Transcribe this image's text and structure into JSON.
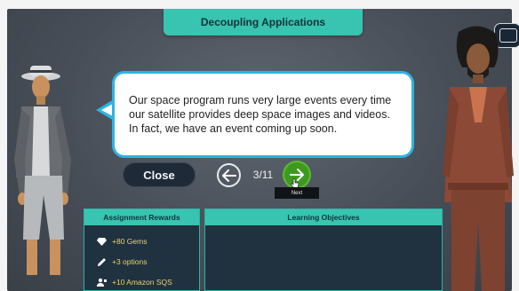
{
  "header": {
    "title": "Decoupling Applications"
  },
  "dialog": {
    "text": "Our space program runs very large events every time our satellite provides deep space images and videos. In fact, we have an event coming up soon.",
    "close_label": "Close",
    "progress": "3/11",
    "next_tooltip": "Next"
  },
  "rewards": {
    "title": "Assignment Rewards",
    "items": [
      {
        "icon": "gem-icon",
        "label": "+80 Gems"
      },
      {
        "icon": "pencil-icon",
        "label": "+3 options"
      },
      {
        "icon": "person-badge-icon",
        "label": "+10 Amazon SQS"
      }
    ]
  },
  "objectives": {
    "title": "Learning Objectives"
  },
  "colors": {
    "accent_teal": "#38c4b0",
    "bubble_border": "#2fb3e0",
    "next_green": "#3e9a1e",
    "reward_text": "#e9d46a",
    "panel_bg": "#203140"
  }
}
